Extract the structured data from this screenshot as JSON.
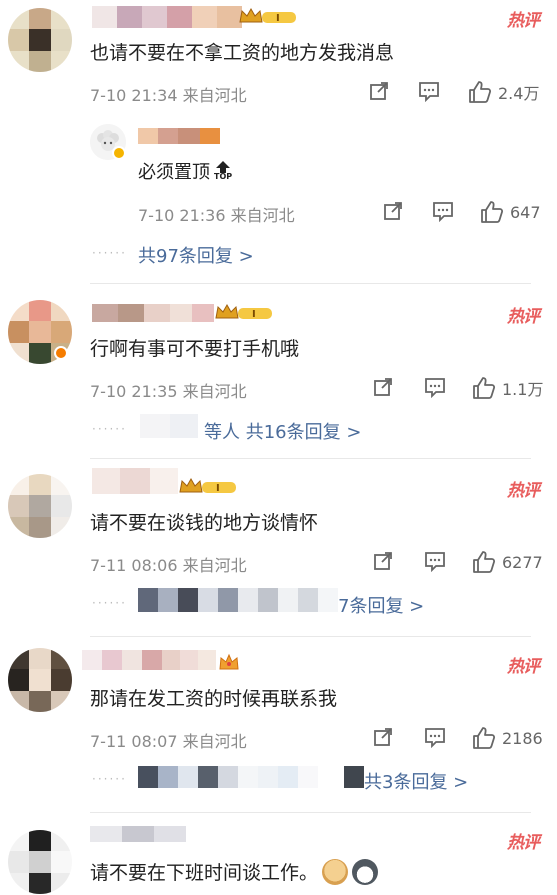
{
  "hot_label": "热评",
  "top_label": "TOP",
  "colors": {
    "hot": "#e85d5d",
    "link": "#4a6b9a",
    "meta": "#8a8a8a"
  },
  "icons": {
    "share": "share-icon",
    "comment": "comment-icon",
    "like": "thumbs-up-icon"
  },
  "comments": [
    {
      "text": "也请不要在不拿工资的地方发我消息",
      "date": "7-10 21:34",
      "location": "来自河北",
      "likes": "2.4万",
      "sub_reply": {
        "text": "必须置顶",
        "date": "7-10 21:36",
        "location": "来自河北",
        "likes": "647"
      },
      "replies_label": "共97条回复 >"
    },
    {
      "text": "行啊有事可不要打手机哦",
      "date": "7-10 21:35",
      "location": "来自河北",
      "likes": "1.1万",
      "replies_label": "等人 共16条回复 >"
    },
    {
      "text": "请不要在谈钱的地方谈情怀",
      "date": "7-11 08:06",
      "location": "来自河北",
      "likes": "6277",
      "replies_label": "7条回复 >"
    },
    {
      "text": "那请在发工资的时候再联系我",
      "date": "7-11 08:07",
      "location": "来自河北",
      "likes": "2186",
      "replies_label": "共3条回复 >"
    },
    {
      "text": "请不要在下班时间谈工作。"
    }
  ]
}
